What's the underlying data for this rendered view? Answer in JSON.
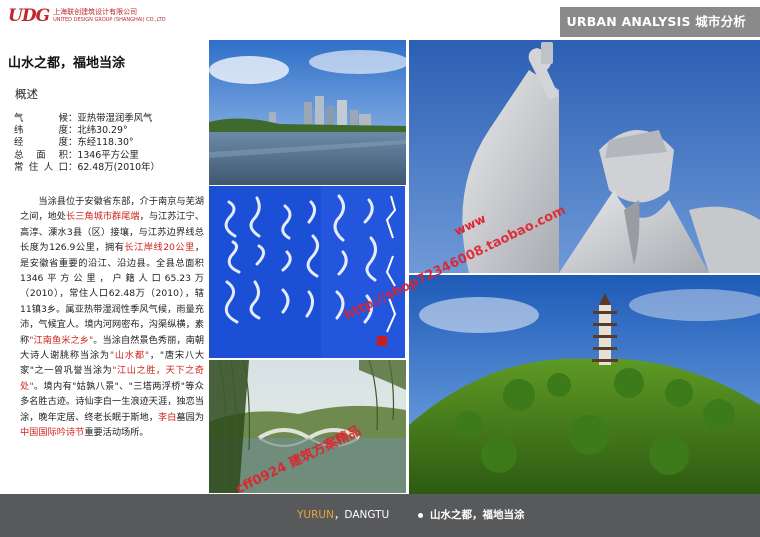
{
  "header": {
    "logo_mark": "UDG",
    "logo_cn": "上海联创建筑设计有限公司",
    "logo_en": "UNITED DESIGN GROUP (SHANGHAI) CO.,LTD",
    "title": "URBAN ANALYSIS 城市分析"
  },
  "content": {
    "page_title": "山水之都，福地当涂",
    "section_title": "概述",
    "facts": [
      {
        "key": "气　　候",
        "value": "：亚热带湿润季风气"
      },
      {
        "key": "纬　　度",
        "value": "：北纬30.29°"
      },
      {
        "key": "经　　度",
        "value": "：东经118.30°"
      },
      {
        "key": "总 面 积",
        "value": "：1346平方公里"
      },
      {
        "key": "常住人口",
        "value": "：62.48万(2010年）"
      }
    ],
    "paragraph": {
      "p1": "　　当涂县位于安徽省东部，介于南京与芜湖之间，地处",
      "h1": "长三角城市群尾端",
      "p2": "，与江苏江宁、高淳、溧水3县（区）接壤，与江苏边界线总长度为126.9公里，拥有",
      "h2": "长江岸线20公里",
      "p3": "，是安徽省重要的沿江、沿边县。全县总面积1346平方公里，户籍人口65.23万（2010），常住人口62.48万（2010），辖11镇3乡。属亚热带湿润性季风气候，雨量充沛，气候宜人。境内河网密布，沟渠纵横，素称",
      "h3": "\"江南鱼米之乡\"",
      "p4": "。当涂自然景色秀丽，南朝大诗人谢朓称当涂为",
      "h4": "\"山水都\"",
      "p5": "，\"唐宋八大家\"之一曾巩誉当涂为",
      "h5": "\"江山之胜，天下之奇处\"",
      "p6": "。境内有\"姑孰八景\"、\"三塔两浮桥\"等众多名胜古迹。诗仙李白一生浪迹天涯，独恋当涂，晚年定居、终老长眠于斯地，",
      "h6": "李白",
      "p7": "墓园为",
      "h7": "中国国际吟诗节",
      "p8": "重要活动场所。"
    }
  },
  "watermarks": {
    "w1": "http://shop72346008.taobao.com",
    "w2": "cff0924  建筑方案精品",
    "w3": "www"
  },
  "footer": {
    "brand_accent": "YURUN",
    "brand_rest": "，DANGTU",
    "section": "山水之都，福地当涂"
  },
  "colors": {
    "accent_red": "#d0261c",
    "header_gray": "#8a8a8a",
    "footer_gray": "#58595b",
    "footer_accent": "#e8a33c"
  }
}
